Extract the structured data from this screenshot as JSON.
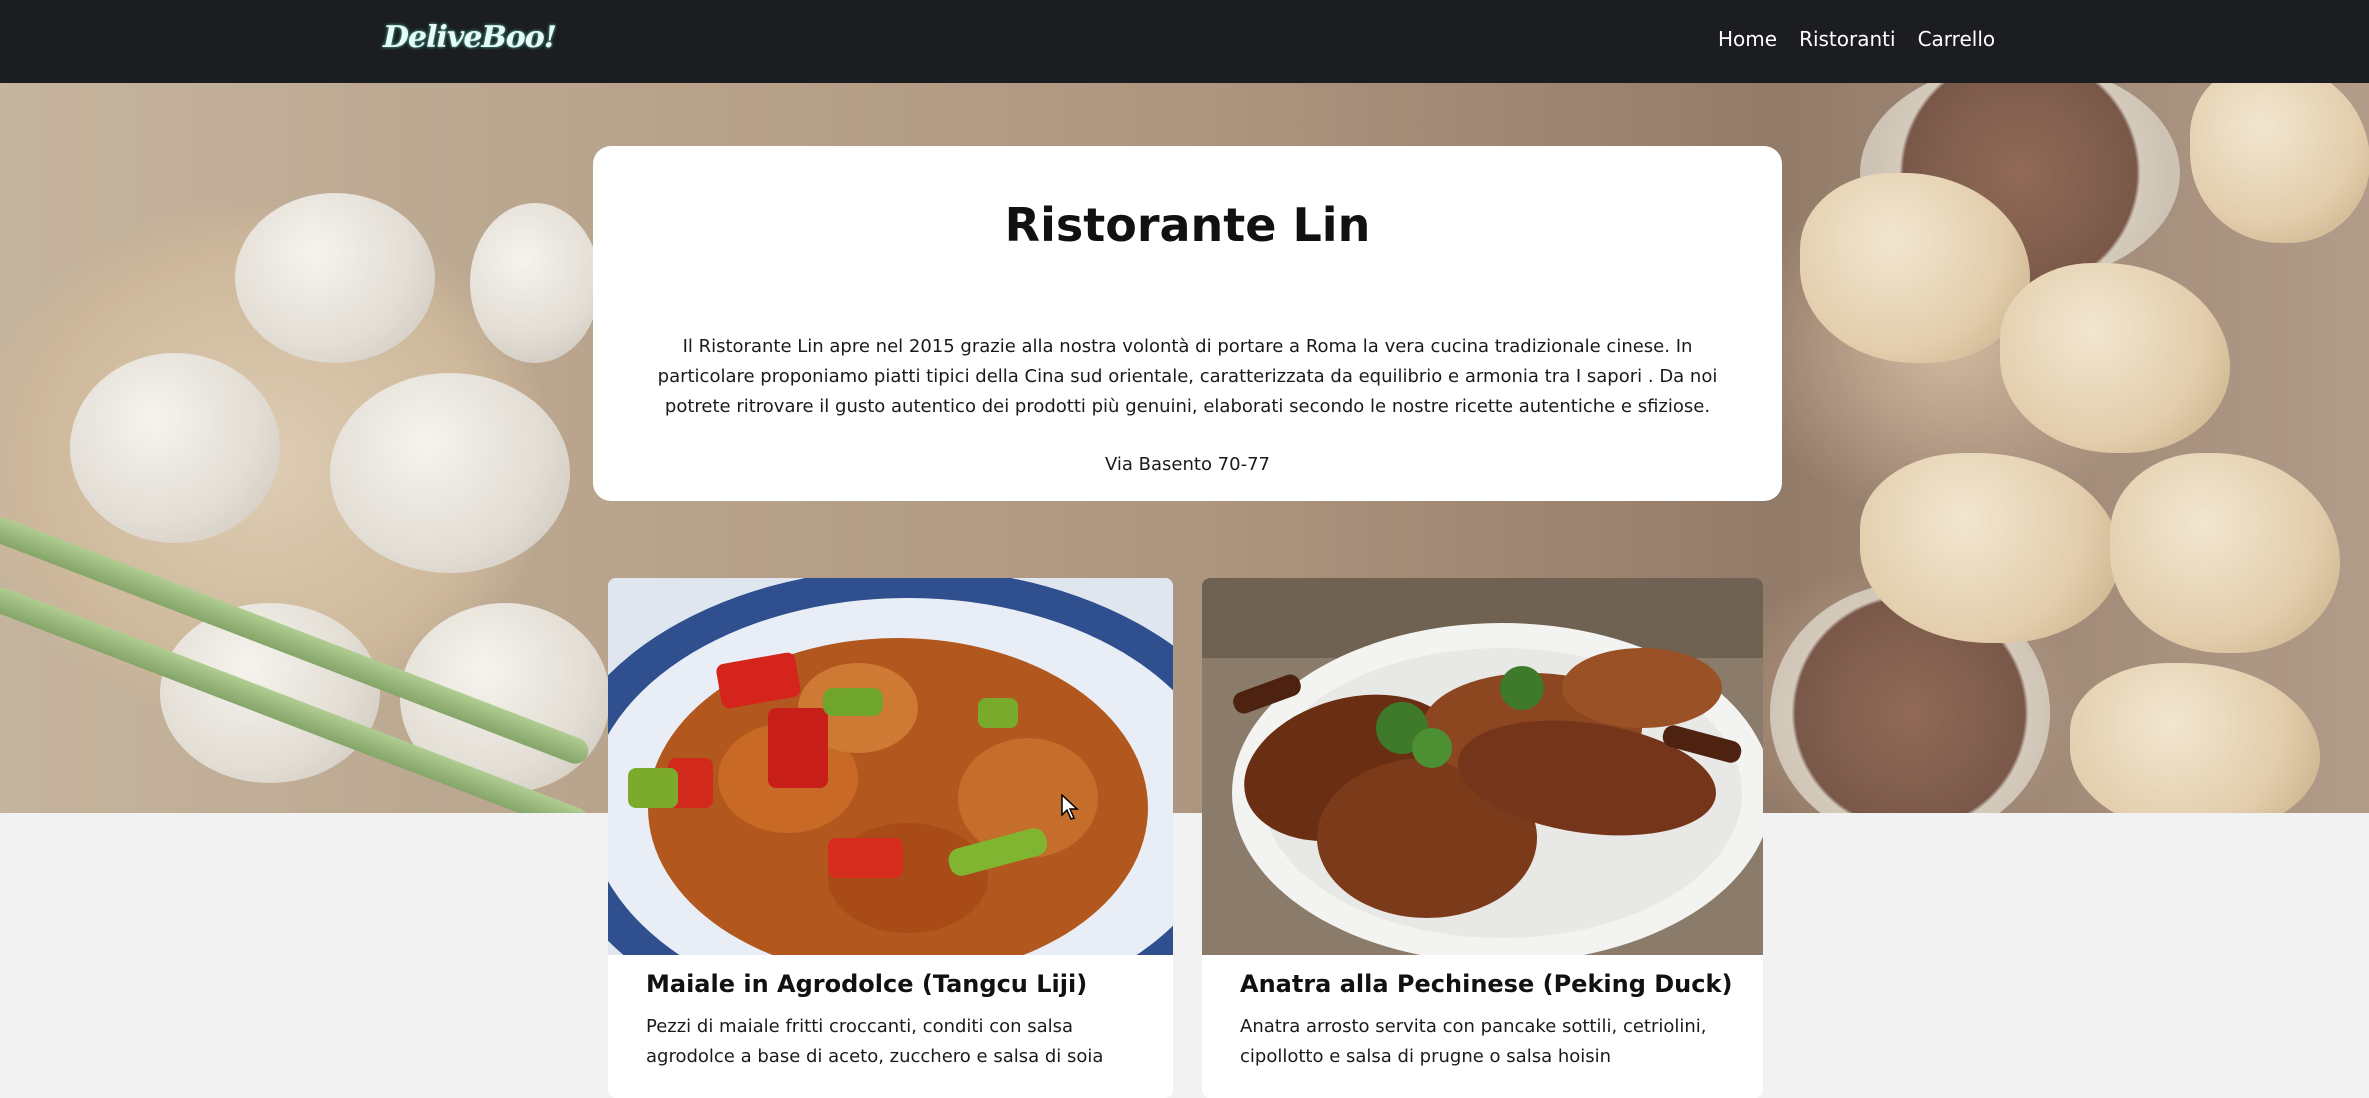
{
  "navbar": {
    "logo_text": "DeliveBoo!",
    "links": [
      {
        "label": "Home"
      },
      {
        "label": "Ristoranti"
      },
      {
        "label": "Carrello"
      }
    ]
  },
  "restaurant": {
    "name": "Ristorante Lin",
    "description": "Il Ristorante Lin apre nel 2015 grazie alla nostra volontà di portare a Roma la vera cucina tradizionale cinese. In particolare proponiamo piatti tipici della Cina sud orientale, caratterizzata da equilibrio e armonia tra I sapori . Da noi potrete ritrovare il gusto autentico dei prodotti più genuini, elaborati secondo le nostre ricette autentiche e sfiziose.",
    "address": "Via Basento 70-77"
  },
  "dishes": [
    {
      "name": "Maiale in Agrodolce (Tangcu Liji)",
      "description": "Pezzi di maiale fritti croccanti, conditi con salsa agrodolce a base di aceto, zucchero e salsa di soia"
    },
    {
      "name": "Anatra alla Pechinese (Peking Duck)",
      "description": "Anatra arrosto servita con pancake sottili, cetriolini, cipollotto e salsa di prugne o salsa hoisin"
    }
  ],
  "colors": {
    "navbar_bg": "#1b1d20",
    "card_bg": "#ffffff",
    "page_bg": "#f2f2f2"
  }
}
